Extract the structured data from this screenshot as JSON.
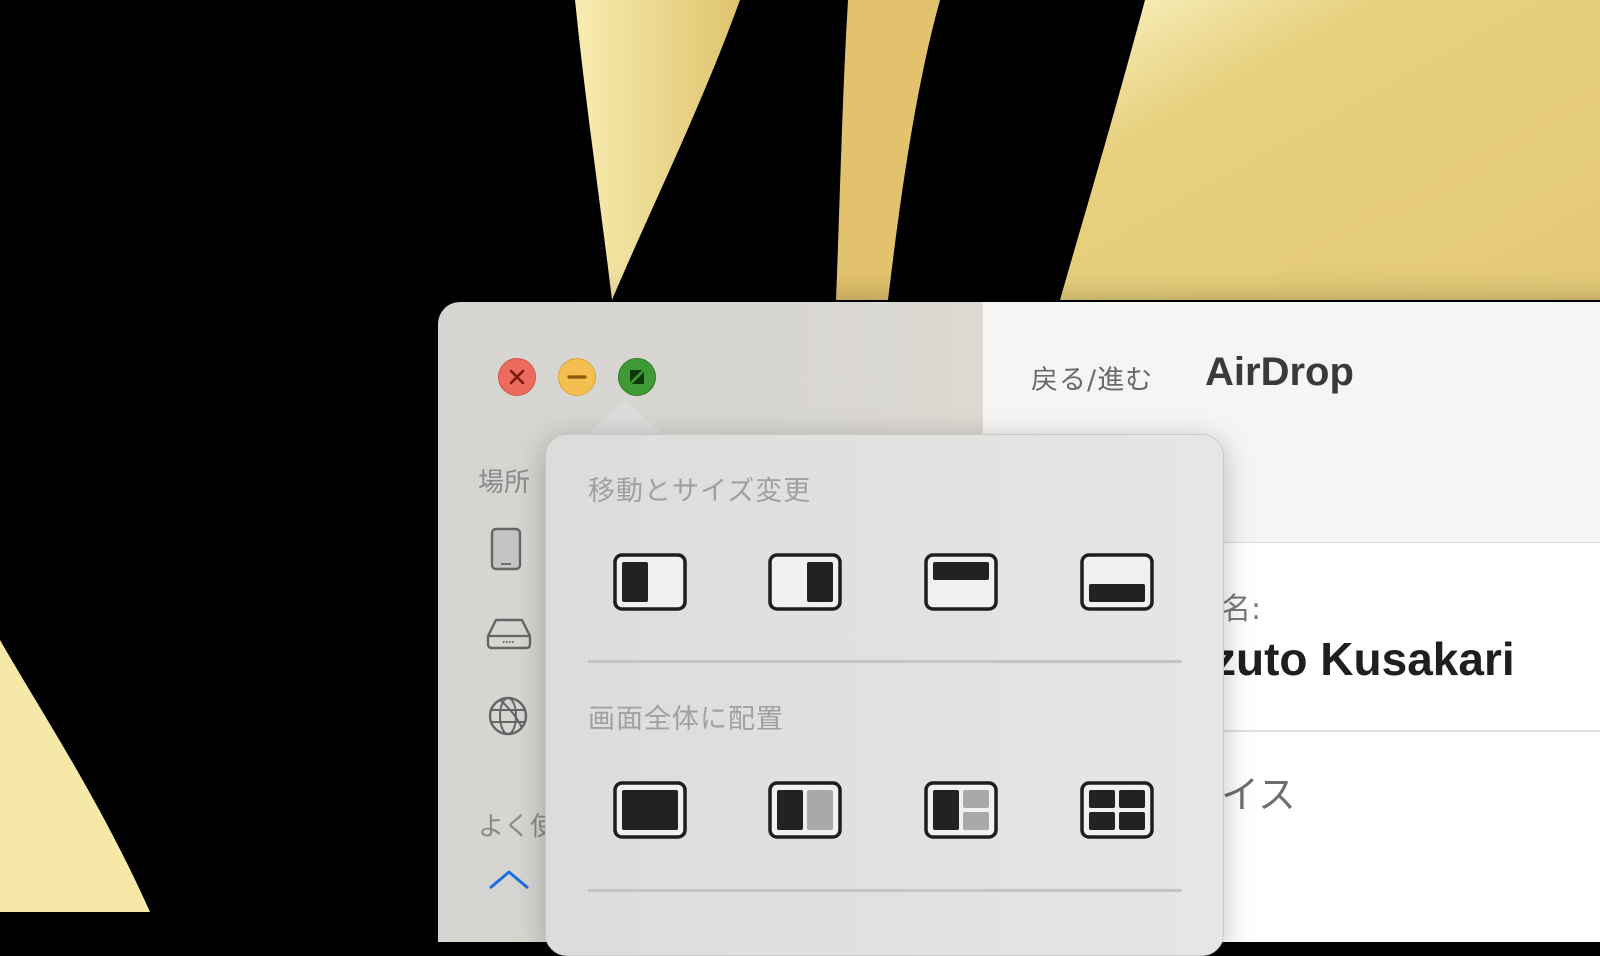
{
  "window": {
    "controls": {
      "close": "close",
      "minimize": "minimize",
      "zoom": "zoom"
    },
    "toolbar": {
      "nav_label": "戻る/進む",
      "title": "AirDrop"
    },
    "sidebar": {
      "section_places": "場所",
      "section_favorites": "よく使",
      "items": [
        {
          "icon": "ipad-icon"
        },
        {
          "icon": "external-drive-icon"
        },
        {
          "icon": "network-globe-icon"
        },
        {
          "icon": "home-icon"
        }
      ]
    },
    "content": {
      "name_label": "名:",
      "name_value": "zuto Kusakari",
      "device_label": "イス"
    }
  },
  "popover": {
    "section1": {
      "title": "移動とサイズ変更",
      "options": [
        {
          "name": "left-half",
          "label": "Left half"
        },
        {
          "name": "right-half",
          "label": "Right half"
        },
        {
          "name": "top-half",
          "label": "Top half"
        },
        {
          "name": "bottom-half",
          "label": "Bottom half"
        }
      ]
    },
    "section2": {
      "title": "画面全体に配置",
      "options": [
        {
          "name": "fill",
          "label": "Fill"
        },
        {
          "name": "left-right",
          "label": "Left & Right"
        },
        {
          "name": "left-quarters",
          "label": "Left & Quarters"
        },
        {
          "name": "quarters",
          "label": "Quarters"
        }
      ]
    }
  },
  "colors": {
    "close": "#ec6a5e",
    "minimize": "#f4bf4f",
    "zoom": "#3d9a35",
    "accent_home": "#1a6fe0",
    "wallpaper_gold": "#e6cf7c"
  }
}
